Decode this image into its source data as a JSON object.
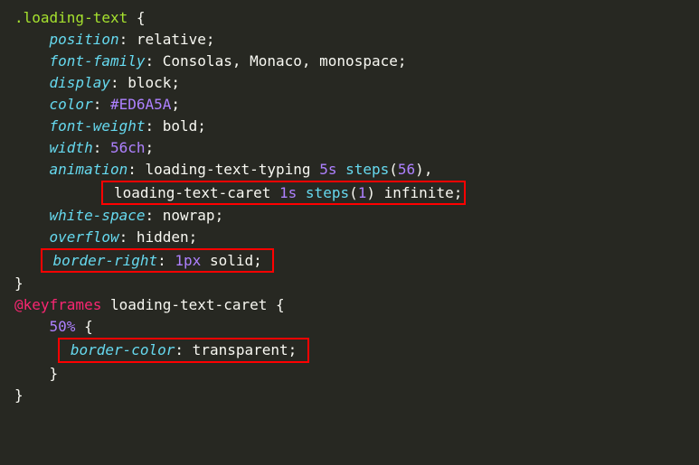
{
  "rules": {
    "selector": ".loading-text",
    "open_brace": "{",
    "close_brace": "}",
    "position": {
      "prop": "position",
      "colon": ": ",
      "value": "relative",
      "semi": ";"
    },
    "fontfamily": {
      "prop": "font-family",
      "colon": ": ",
      "value": "Consolas, Monaco, monospace",
      "semi": ";"
    },
    "display": {
      "prop": "display",
      "colon": ": ",
      "value": "block",
      "semi": ";"
    },
    "color": {
      "prop": "color",
      "colon": ": ",
      "value": "#ED6A5A",
      "semi": ";"
    },
    "fontweight": {
      "prop": "font-weight",
      "colon": ": ",
      "value": "bold",
      "semi": ";"
    },
    "width": {
      "prop": "width",
      "colon": ": ",
      "num": "56",
      "unit": "ch",
      "semi": ";"
    },
    "animation": {
      "prop": "animation",
      "colon": ": ",
      "part1_a": "loading",
      "part1_dash1": "-",
      "part1_b": "text",
      "part1_dash2": "-",
      "part1_c": "typing ",
      "dur1": "5s ",
      "fn1": "steps",
      "paren1o": "(",
      "arg1": "56",
      "paren1c": ")",
      "comma": ",",
      "part2_a": "loading",
      "part2_dash1": "-",
      "part2_b": "text",
      "part2_dash2": "-",
      "part2_c": "caret ",
      "dur2": "1s ",
      "fn2": "steps",
      "paren2o": "(",
      "arg2": "1",
      "paren2c": ") ",
      "inf": "infinite",
      "semi": ";"
    },
    "whitespace": {
      "prop": "white-space",
      "colon": ": ",
      "value": "nowrap",
      "semi": ";"
    },
    "overflow": {
      "prop": "overflow",
      "colon": ": ",
      "value": "hidden",
      "semi": ";"
    },
    "borderright": {
      "prop": "border-right",
      "colon": ": ",
      "num": "1",
      "unit": "px ",
      "value": "solid",
      "semi": ";"
    }
  },
  "keyframes": {
    "at": "@keyframes",
    "name": " loading-text-caret ",
    "open_brace": "{",
    "stop": {
      "pct": "50%",
      "open_brace": " {",
      "bordercolor": {
        "prop": "border-color",
        "colon": ": ",
        "value": "transparent",
        "semi": ";"
      },
      "close_brace": "}"
    },
    "close_brace": "}"
  }
}
